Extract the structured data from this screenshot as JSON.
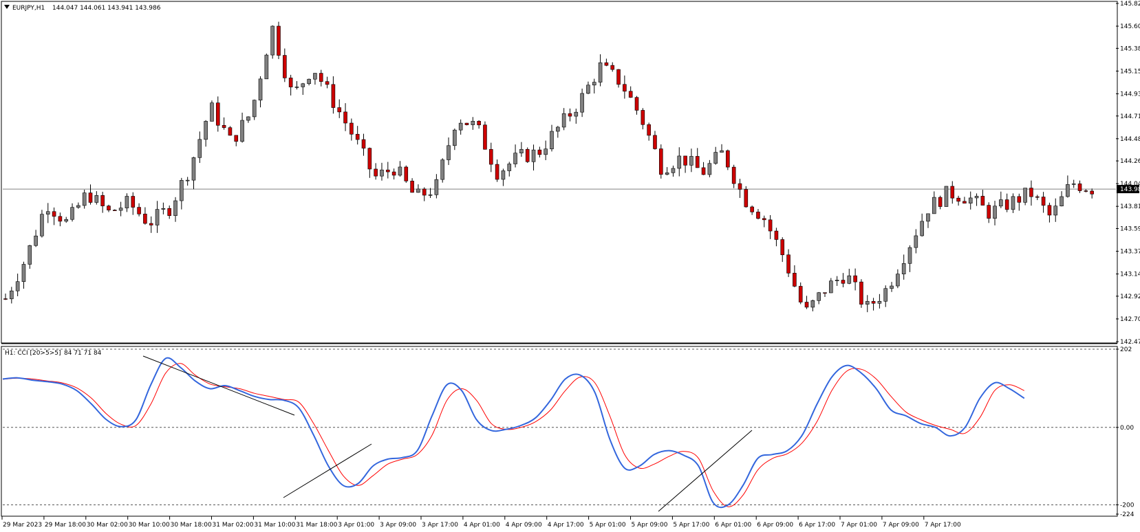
{
  "header": {
    "symbol_label": "EURJPY,H1",
    "ohlc_label": "144.047 144.061 143.941 143.986",
    "indicator_label": "H1: CCI [20>5>5]",
    "indicator_values": "84 71 71 84"
  },
  "price_axis": {
    "ticks": [
      "145.825",
      "145.600",
      "145.380",
      "145.155",
      "144.930",
      "144.710",
      "144.485",
      "144.265",
      "144.040",
      "143.815",
      "143.595",
      "143.370",
      "143.145",
      "142.925",
      "142.700",
      "142.475"
    ],
    "current_price_label": "143.986"
  },
  "indicator_axis": {
    "ticks": [
      "202",
      "0.00",
      "-200",
      "-224"
    ]
  },
  "time_axis": {
    "labels": [
      "29 Mar 2023",
      "29 Mar 18:00",
      "30 Mar 02:00",
      "30 Mar 10:00",
      "30 Mar 18:00",
      "31 Mar 02:00",
      "31 Mar 10:00",
      "31 Mar 18:00",
      "3 Apr 01:00",
      "3 Apr 09:00",
      "3 Apr 17:00",
      "4 Apr 01:00",
      "4 Apr 09:00",
      "4 Apr 17:00",
      "5 Apr 01:00",
      "5 Apr 09:00",
      "5 Apr 17:00",
      "6 Apr 01:00",
      "6 Apr 09:00",
      "6 Apr 17:00",
      "7 Apr 01:00",
      "7 Apr 09:00",
      "7 Apr 17:00"
    ]
  },
  "colors": {
    "bull": "#808080",
    "bear": "#cc0000",
    "wick": "#000000",
    "cci_main": "#3366dd",
    "cci_signal": "#ff0000",
    "grid_line": "#808080",
    "axis_bg": "#ffffff",
    "price_tag_bg": "#000000"
  },
  "chart_data": [
    {
      "type": "candlestick",
      "title": "EURJPY,H1",
      "ylim": [
        142.475,
        145.825
      ],
      "current_price": 143.986,
      "x": [
        "29 Mar 2023",
        "29 Mar 18:00",
        "30 Mar 02:00",
        "30 Mar 10:00",
        "30 Mar 18:00",
        "31 Mar 02:00",
        "31 Mar 10:00",
        "31 Mar 18:00",
        "3 Apr 01:00",
        "3 Apr 09:00",
        "3 Apr 17:00",
        "4 Apr 01:00",
        "4 Apr 09:00",
        "4 Apr 17:00",
        "5 Apr 01:00",
        "5 Apr 09:00",
        "5 Apr 17:00",
        "6 Apr 01:00",
        "6 Apr 09:00",
        "6 Apr 17:00",
        "7 Apr 01:00",
        "7 Apr 09:00",
        "7 Apr 17:00"
      ],
      "close_path": [
        142.9,
        143.3,
        143.85,
        143.65,
        143.95,
        143.75,
        143.85,
        143.65,
        143.8,
        144.2,
        144.8,
        144.45,
        144.75,
        145.6,
        144.9,
        145.2,
        144.85,
        144.5,
        144.1,
        144.2,
        143.9,
        144.0,
        144.7,
        144.6,
        144.15,
        144.3,
        144.35,
        144.6,
        144.85,
        145.2,
        145.05,
        144.7,
        144.2,
        144.3,
        144.15,
        144.35,
        143.9,
        143.7,
        143.3,
        142.75,
        143.0,
        143.15,
        142.8,
        143.0,
        143.4,
        143.8,
        143.95,
        143.9,
        143.75,
        143.85,
        143.95,
        143.7,
        144.05,
        143.99
      ]
    },
    {
      "type": "line",
      "title": "H1: CCI [20>5>5]",
      "ylim": [
        -224,
        202
      ],
      "levels": [
        202,
        0,
        -200
      ],
      "series": [
        {
          "name": "CCI",
          "values": [
            125,
            128,
            122,
            118,
            112,
            95,
            60,
            20,
            2,
            20,
            110,
            178,
            155,
            120,
            100,
            108,
            95,
            80,
            72,
            70,
            50,
            -20,
            -100,
            -150,
            -145,
            -100,
            -82,
            -78,
            -60,
            30,
            110,
            95,
            20,
            -8,
            -5,
            5,
            25,
            70,
            125,
            135,
            90,
            -30,
            -105,
            -100,
            -70,
            -60,
            -72,
            -100,
            -195,
            -200,
            -150,
            -80,
            -70,
            -60,
            -20,
            60,
            130,
            160,
            140,
            100,
            45,
            30,
            10,
            0,
            -22,
            0,
            75,
            115,
            100,
            75
          ]
        },
        {
          "name": "Signal",
          "values": [
            124,
            127,
            125,
            120,
            115,
            102,
            75,
            35,
            8,
            5,
            60,
            140,
            165,
            135,
            112,
            105,
            100,
            88,
            80,
            72,
            65,
            10,
            -60,
            -125,
            -150,
            -125,
            -95,
            -82,
            -70,
            -20,
            70,
            100,
            70,
            10,
            -5,
            0,
            15,
            45,
            95,
            130,
            115,
            30,
            -70,
            -105,
            -95,
            -75,
            -62,
            -80,
            -165,
            -205,
            -175,
            -110,
            -80,
            -68,
            -40,
            15,
            95,
            145,
            150,
            125,
            80,
            40,
            20,
            5,
            -5,
            -15,
            25,
            95,
            110,
            95
          ]
        }
      ]
    }
  ]
}
